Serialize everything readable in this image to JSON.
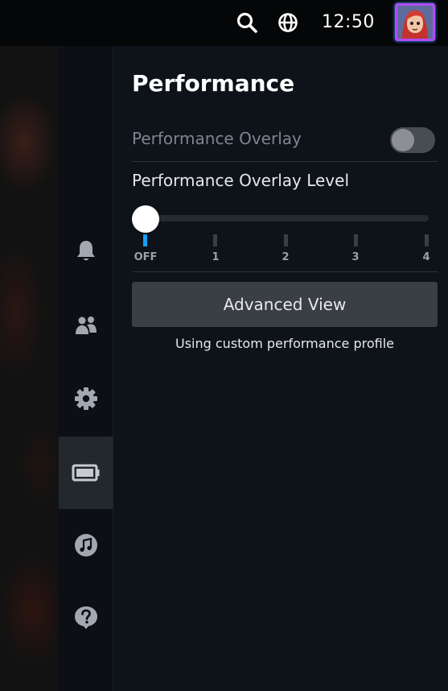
{
  "topbar": {
    "clock": "12:50",
    "icons": [
      "search-icon",
      "globe-icon"
    ],
    "avatar_border_color": "#b34bff"
  },
  "sidenav": {
    "items": [
      {
        "name": "notifications",
        "icon": "bell-icon"
      },
      {
        "name": "friends",
        "icon": "friends-icon"
      },
      {
        "name": "settings",
        "icon": "gear-icon"
      },
      {
        "name": "performance",
        "icon": "battery-icon",
        "active": true
      },
      {
        "name": "music",
        "icon": "music-icon"
      },
      {
        "name": "help",
        "icon": "help-icon"
      }
    ]
  },
  "panel": {
    "title": "Performance",
    "overlay_toggle": {
      "label": "Performance Overlay",
      "state": "off"
    },
    "overlay_level": {
      "label": "Performance Overlay Level",
      "ticks": [
        "OFF",
        "1",
        "2",
        "3",
        "4"
      ],
      "selected_index": 0
    },
    "advanced_button": "Advanced View",
    "profile_note": "Using custom performance profile"
  },
  "colors": {
    "accent": "#1a9fff",
    "panel_bg": "#0e131a",
    "button_bg": "#3a3e45"
  }
}
